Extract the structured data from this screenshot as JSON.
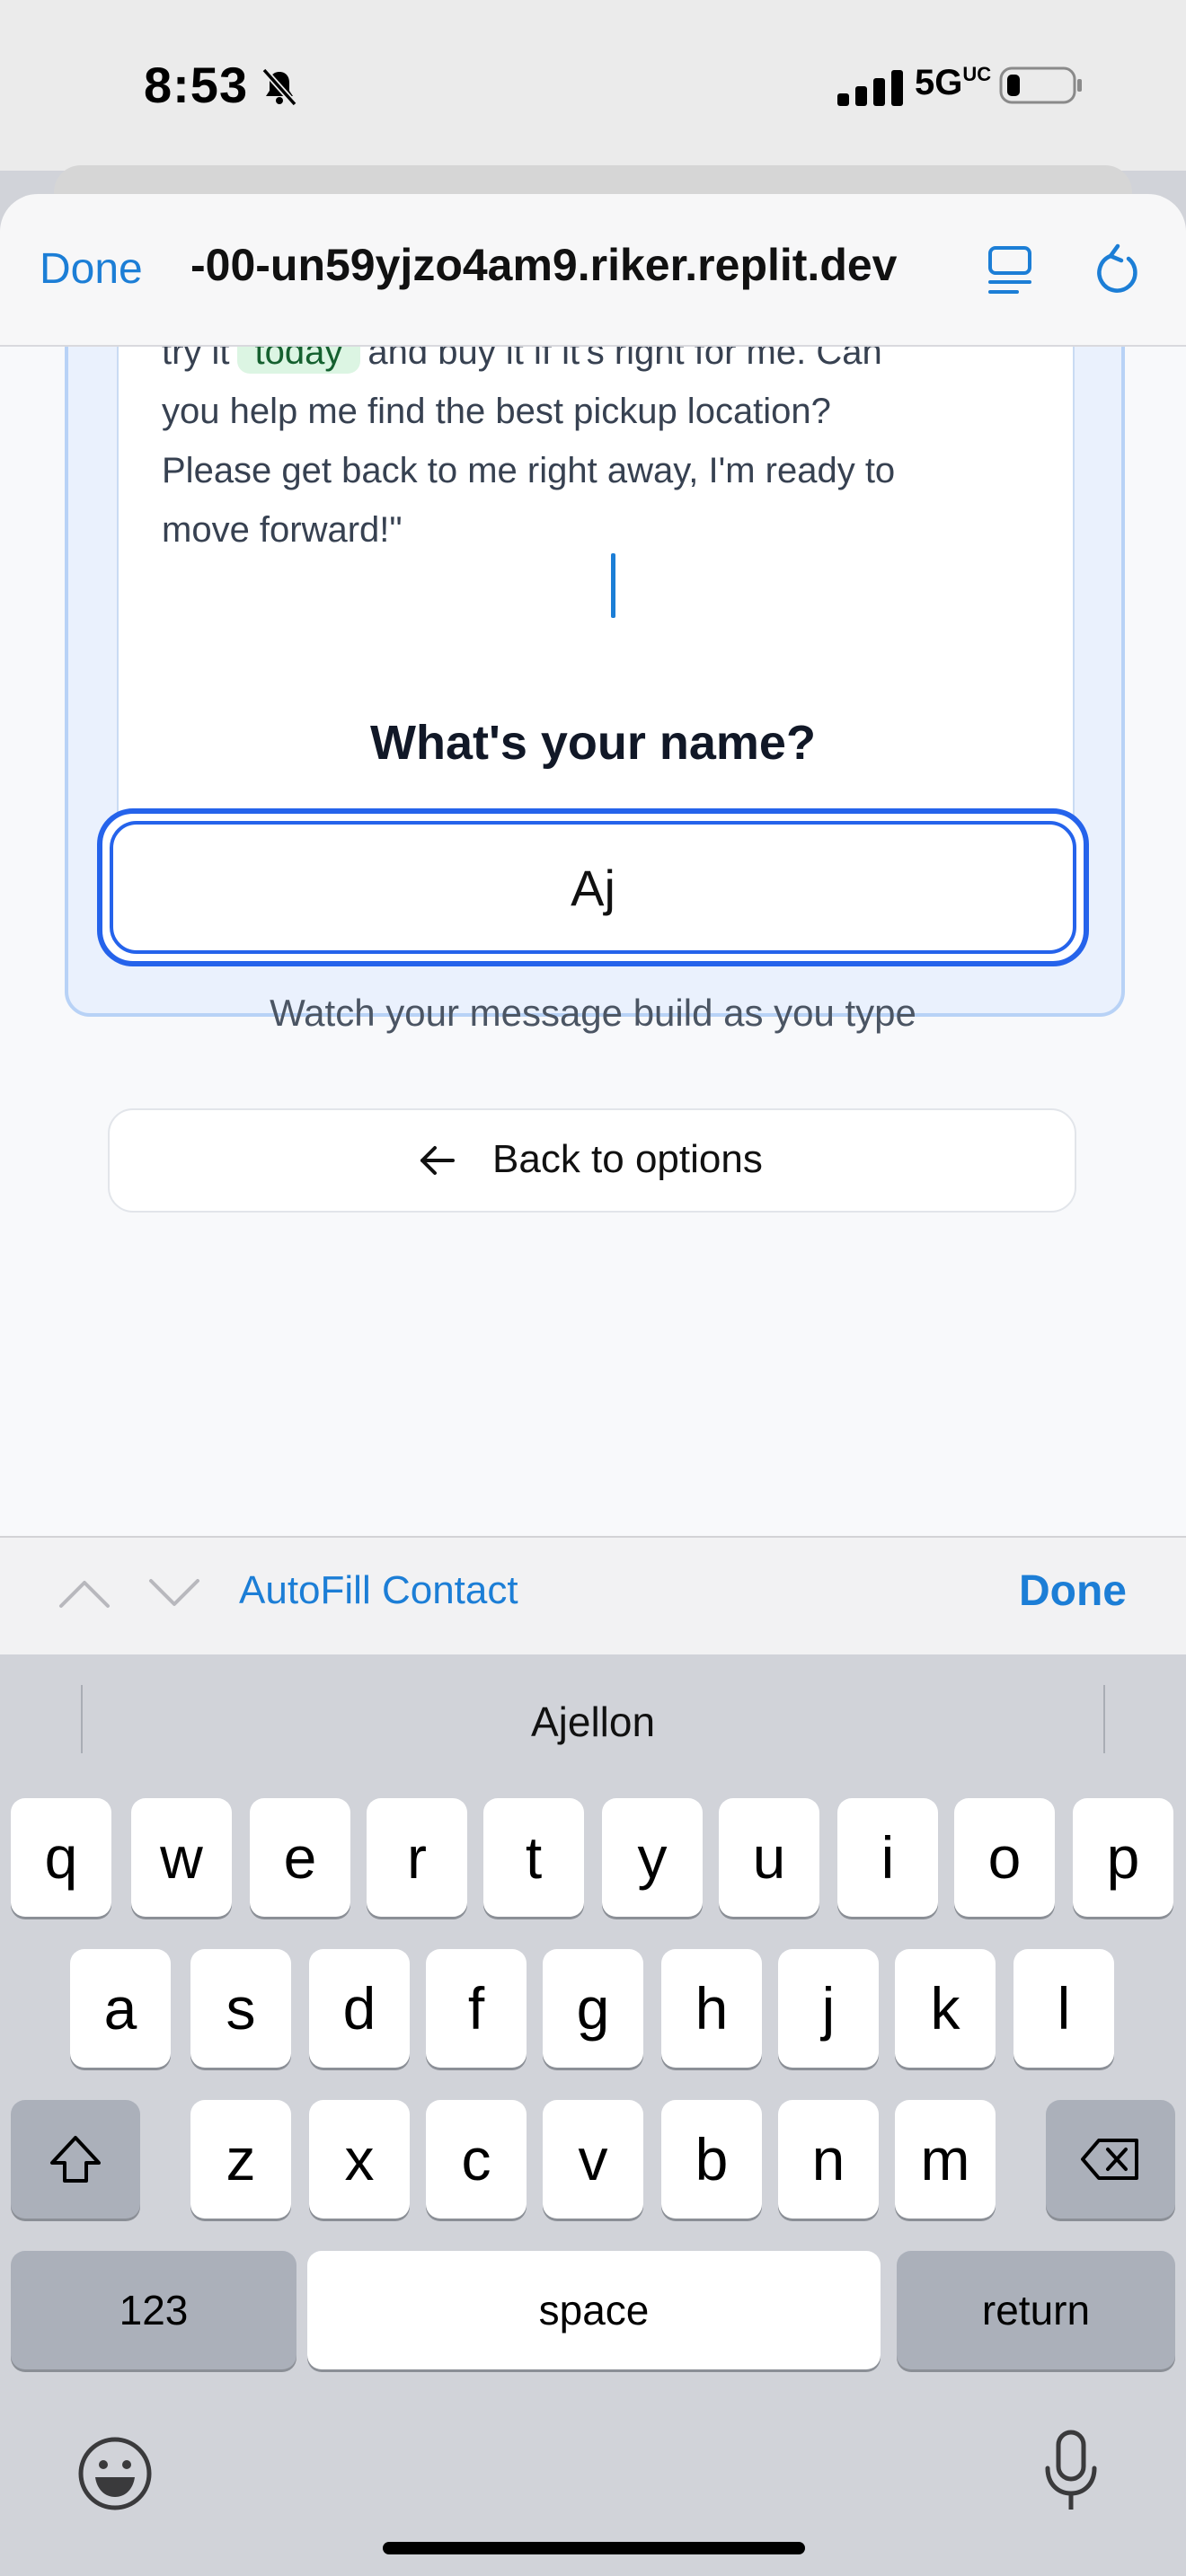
{
  "status_bar": {
    "time": "8:53",
    "network": "5G",
    "network_suffix": "UC"
  },
  "browser": {
    "done_label": "Done",
    "url": "-00-un59yjzo4am9.riker.replit.dev"
  },
  "message_card": {
    "line1_pre": "try it",
    "line1_highlight": "today",
    "line1_post": "and buy it if it's right for me. Can",
    "line2": "you help me find the best pickup location?",
    "line3": "Please get back to me right away, I'm ready to",
    "line4": "move forward!\""
  },
  "form": {
    "title": "What's your name?",
    "name_value": "Aj",
    "hint": "Watch your message build as you type",
    "back_label": "Back to options"
  },
  "accessory_bar": {
    "autofill_label": "AutoFill Contact",
    "done_label": "Done"
  },
  "keyboard": {
    "suggestion": "Ajellon",
    "row1": [
      "q",
      "w",
      "e",
      "r",
      "t",
      "y",
      "u",
      "i",
      "o",
      "p"
    ],
    "row2": [
      "a",
      "s",
      "d",
      "f",
      "g",
      "h",
      "j",
      "k",
      "l"
    ],
    "row3": [
      "z",
      "x",
      "c",
      "v",
      "b",
      "n",
      "m"
    ],
    "numbers_label": "123",
    "space_label": "space",
    "return_label": "return"
  },
  "colors": {
    "accent": "#1c7ed6",
    "input_border": "#2563eb",
    "highlight_bg": "#dcf5e3"
  }
}
